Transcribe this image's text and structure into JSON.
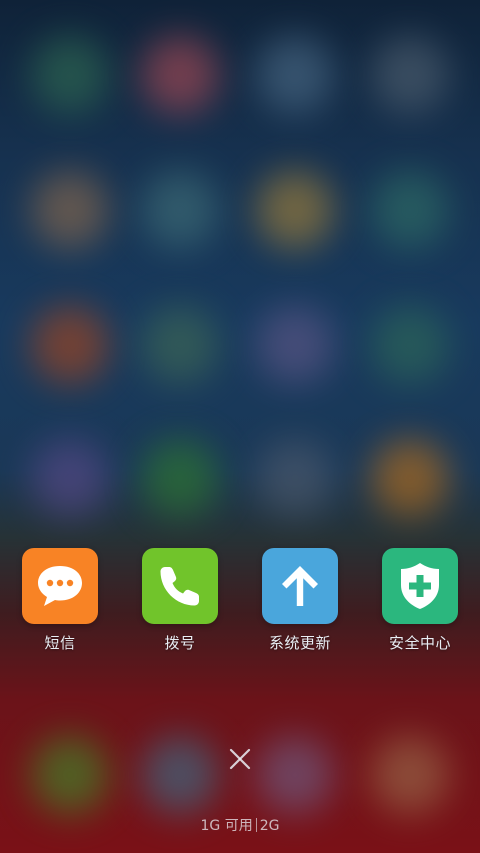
{
  "background": {
    "blobs": [
      {
        "color": "#2f6b52"
      },
      {
        "color": "#a84a55"
      },
      {
        "color": "#4a6a86"
      },
      {
        "color": "#4f6070"
      },
      {
        "color": "#8a6a4e"
      },
      {
        "color": "#3f6f78"
      },
      {
        "color": "#a2813a"
      },
      {
        "color": "#2f6f66"
      },
      {
        "color": "#a5461f"
      },
      {
        "color": "#3f6a55"
      },
      {
        "color": "#5e5788"
      },
      {
        "color": "#2e6a58"
      },
      {
        "color": "#5a4a8a"
      },
      {
        "color": "#2f7a2f"
      },
      {
        "color": "#4e5b6e"
      },
      {
        "color": "#b86f1a"
      },
      {
        "color": "#3f8a2a"
      },
      {
        "color": "#3a6f8a"
      },
      {
        "color": "#6e5e86"
      },
      {
        "color": "#9a6a4a"
      }
    ]
  },
  "dock": {
    "apps": [
      {
        "label": "短信",
        "icon": "message-bubble-icon",
        "color": "#f88325"
      },
      {
        "label": "拨号",
        "icon": "phone-icon",
        "color": "#71c42b"
      },
      {
        "label": "系统更新",
        "icon": "arrow-up-icon",
        "color": "#4aa6dc"
      },
      {
        "label": "安全中心",
        "icon": "shield-plus-icon",
        "color": "#2bb77e"
      }
    ]
  },
  "close": {
    "icon": "close-icon"
  },
  "memory": {
    "available": "1G 可用",
    "total": "2G"
  }
}
